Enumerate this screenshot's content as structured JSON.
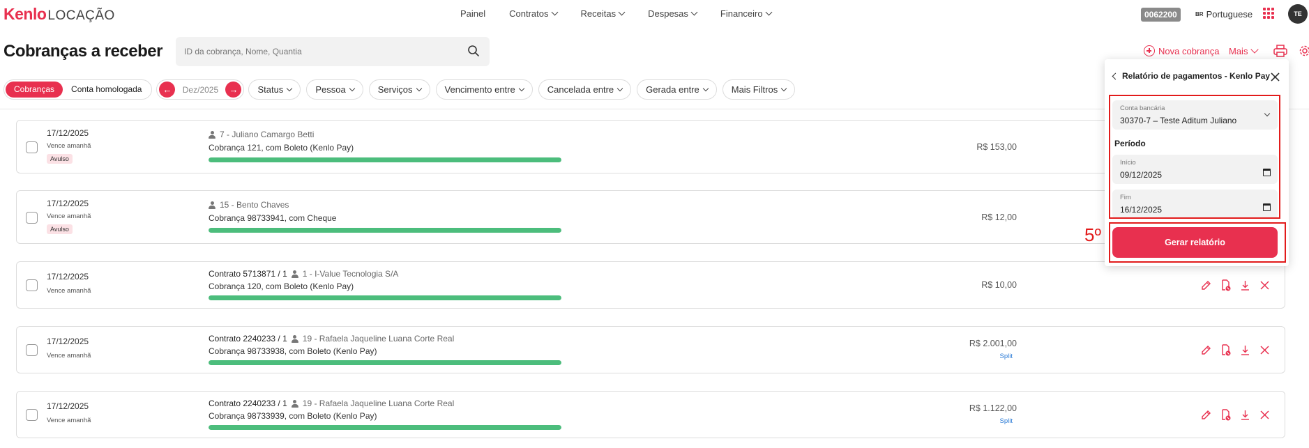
{
  "app": {
    "logo_brand": "Kenlo",
    "logo_product": "LOCAÇÃO"
  },
  "nav": {
    "items": [
      {
        "label": "Painel",
        "dropdown": false
      },
      {
        "label": "Contratos",
        "dropdown": true
      },
      {
        "label": "Receitas",
        "dropdown": true
      },
      {
        "label": "Despesas",
        "dropdown": true
      },
      {
        "label": "Financeiro",
        "dropdown": true
      }
    ]
  },
  "topbar": {
    "code": "0062200",
    "lang_flag": "BR",
    "language": "Portuguese",
    "avatar": "TE"
  },
  "page": {
    "title": "Cobranças a receber",
    "search_placeholder": "ID da cobrança, Nome, Quantia",
    "new_charge": "Nova cobrança",
    "more": "Mais"
  },
  "filters": {
    "segments": [
      "Cobranças",
      "Conta homologada"
    ],
    "active_segment": "Cobranças",
    "month": "Dez/2025",
    "chips": [
      "Status",
      "Pessoa",
      "Serviços",
      "Vencimento entre",
      "Cancelada entre",
      "Gerada entre",
      "Mais Filtros"
    ]
  },
  "rows": [
    {
      "date": "17/12/2025",
      "due": "Vence amanhã",
      "tag": "Avulso",
      "contract": "",
      "person": "7 - Juliano Camargo Betti",
      "desc": "Cobrança 121, com Boleto (Kenlo Pay)",
      "amount": "R$ 153,00",
      "split": "",
      "progress": 1.0
    },
    {
      "date": "17/12/2025",
      "due": "Vence amanhã",
      "tag": "Avulso",
      "contract": "",
      "person": "15 - Bento Chaves",
      "desc": "Cobrança 98733941, com Cheque",
      "amount": "R$ 12,00",
      "split": "",
      "progress": 1.0
    },
    {
      "date": "17/12/2025",
      "due": "Vence amanhã",
      "tag": "",
      "contract": "Contrato 5713871 / 1",
      "person": "1 - I-Value Tecnologia S/A",
      "desc": "Cobrança 120, com Boleto (Kenlo Pay)",
      "amount": "R$ 10,00",
      "split": "",
      "progress": 1.0
    },
    {
      "date": "17/12/2025",
      "due": "Vence amanhã",
      "tag": "",
      "contract": "Contrato 2240233 / 1",
      "person": "19 - Rafaela Jaqueline Luana Corte Real",
      "desc": "Cobrança 98733938, com Boleto (Kenlo Pay)",
      "amount": "R$ 2.001,00",
      "split": "Split",
      "progress": 1.0
    },
    {
      "date": "17/12/2025",
      "due": "Vence amanhã",
      "tag": "",
      "contract": "Contrato 2240233 / 1",
      "person": "19 - Rafaela Jaqueline Luana Corte Real",
      "desc": "Cobrança 98733939, com Boleto (Kenlo Pay)",
      "amount": "R$ 1.122,00",
      "split": "Split",
      "progress": 1.0
    }
  ],
  "panel": {
    "title": "Relatório de pagamentos - Kenlo Pay",
    "bank_label": "Conta bancária",
    "bank_value": "30370-7 – Teste Aditum Juliano",
    "period_label": "Período",
    "start_label": "Início",
    "start_value": "09/12/2025",
    "end_label": "Fim",
    "end_value": "16/12/2025",
    "generate": "Gerar relatório"
  },
  "annotation": {
    "step": "5º",
    "color": "#e21b1b"
  },
  "colors": {
    "brand": "#e8304f",
    "progress": "#4cbd7c",
    "split": "#2b7bd6"
  }
}
